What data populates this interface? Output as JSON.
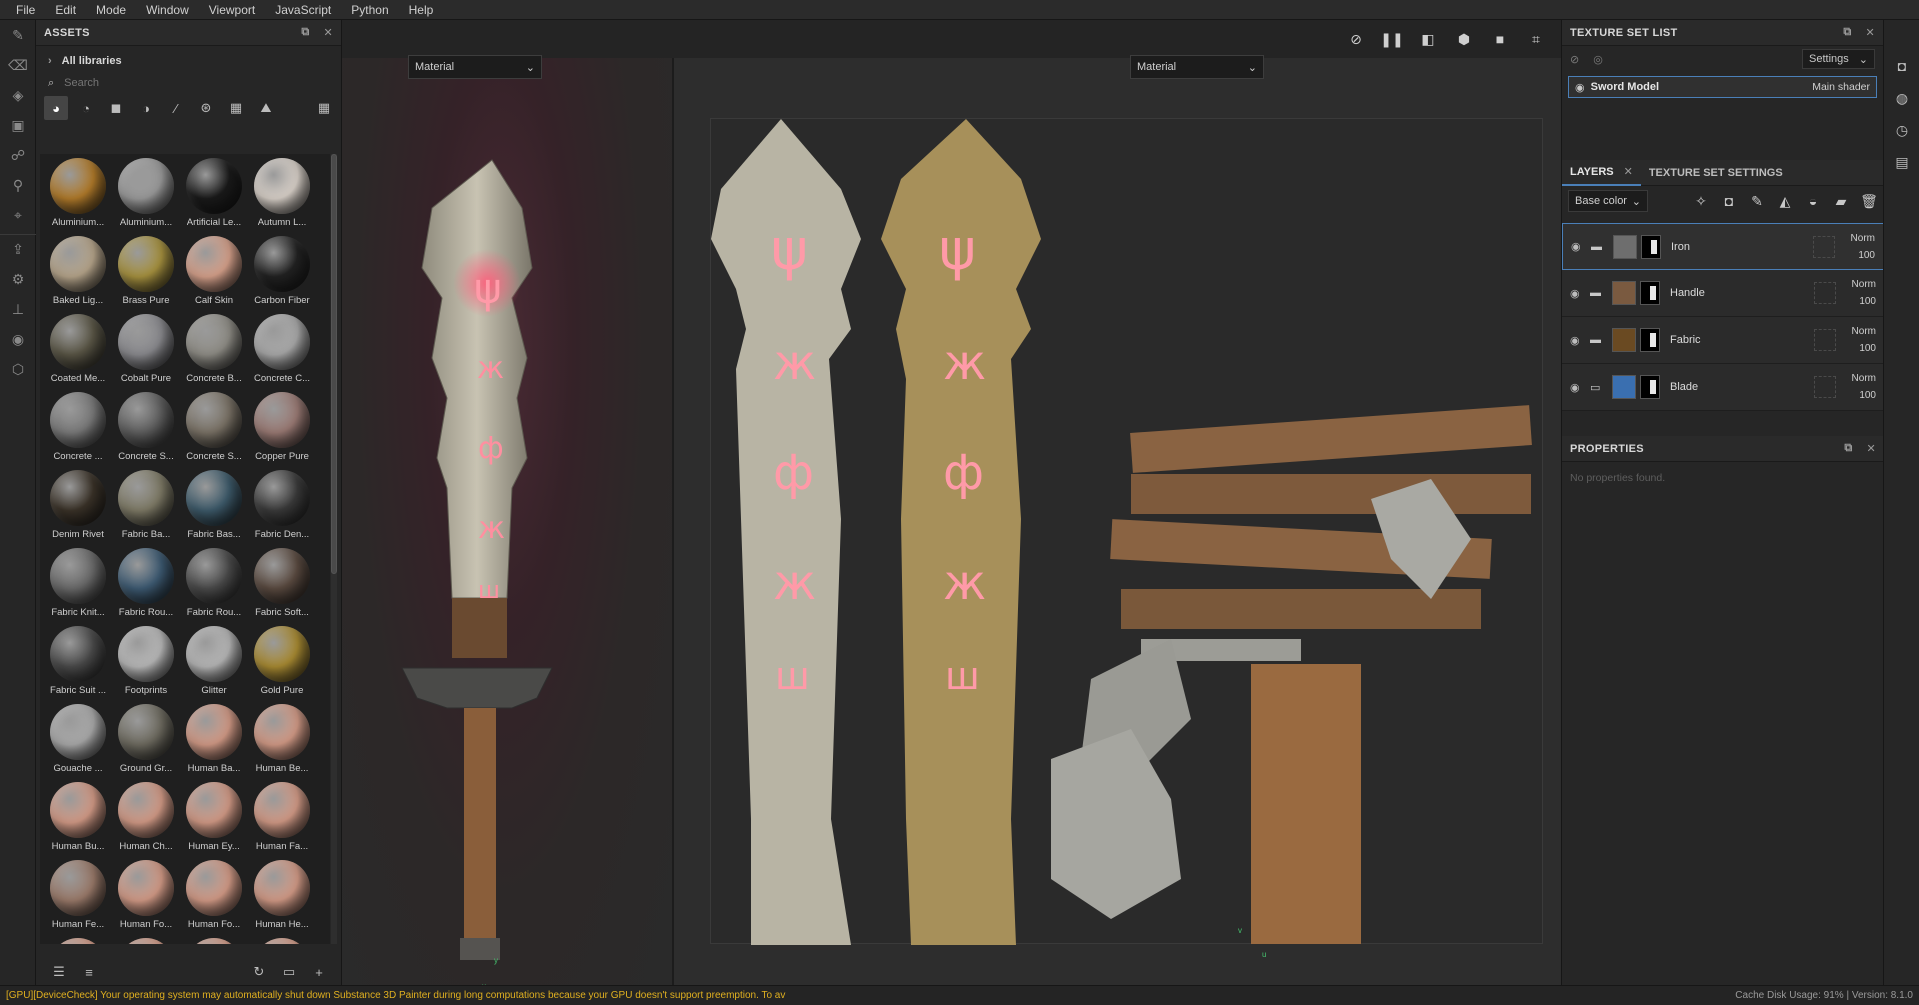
{
  "menu": [
    "File",
    "Edit",
    "Mode",
    "Window",
    "Viewport",
    "JavaScript",
    "Python",
    "Help"
  ],
  "assets": {
    "title": "ASSETS",
    "library": "All libraries",
    "search_placeholder": "Search",
    "items": [
      {
        "label": "Aluminium...",
        "color": "#b07a2a"
      },
      {
        "label": "Aluminium...",
        "color": "#9a9a9a"
      },
      {
        "label": "Artificial Le...",
        "color": "#1a1a1a"
      },
      {
        "label": "Autumn L...",
        "color": "#d8d0c8"
      },
      {
        "label": "Baked Lig...",
        "color": "#b5a48a"
      },
      {
        "label": "Brass Pure",
        "color": "#a6913f"
      },
      {
        "label": "Calf Skin",
        "color": "#d5a08a"
      },
      {
        "label": "Carbon Fiber",
        "color": "#222222"
      },
      {
        "label": "Coated Me...",
        "color": "#5a5646"
      },
      {
        "label": "Cobalt Pure",
        "color": "#8a8a8e"
      },
      {
        "label": "Concrete B...",
        "color": "#8f8d86"
      },
      {
        "label": "Concrete C...",
        "color": "#a9a9a9"
      },
      {
        "label": "Concrete ...",
        "color": "#7a7a7a"
      },
      {
        "label": "Concrete S...",
        "color": "#5f5f5f"
      },
      {
        "label": "Concrete S...",
        "color": "#7a7266"
      },
      {
        "label": "Copper Pure",
        "color": "#9a7a74"
      },
      {
        "label": "Denim Rivet",
        "color": "#3a3228"
      },
      {
        "label": "Fabric Ba...",
        "color": "#7e7a66"
      },
      {
        "label": "Fabric Bas...",
        "color": "#3d5a6a"
      },
      {
        "label": "Fabric Den...",
        "color": "#3a3a3a"
      },
      {
        "label": "Fabric Knit...",
        "color": "#6a6a6a"
      },
      {
        "label": "Fabric Rou...",
        "color": "#3d5a72"
      },
      {
        "label": "Fabric Rou...",
        "color": "#4a4a4a"
      },
      {
        "label": "Fabric Soft...",
        "color": "#5a4a40"
      },
      {
        "label": "Fabric Suit ...",
        "color": "#4a4a4a"
      },
      {
        "label": "Footprints",
        "color": "#b8b8b8"
      },
      {
        "label": "Glitter",
        "color": "#b6b6b6"
      },
      {
        "label": "Gold Pure",
        "color": "#a88a32"
      },
      {
        "label": "Gouache ...",
        "color": "#a9a9a9"
      },
      {
        "label": "Ground Gr...",
        "color": "#6e6b60"
      },
      {
        "label": "Human Ba...",
        "color": "#d29a86"
      },
      {
        "label": "Human Be...",
        "color": "#d29a86"
      },
      {
        "label": "Human Bu...",
        "color": "#d29a86"
      },
      {
        "label": "Human Ch...",
        "color": "#d29a86"
      },
      {
        "label": "Human Ey...",
        "color": "#d29a86"
      },
      {
        "label": "Human Fa...",
        "color": "#d29a86"
      },
      {
        "label": "Human Fe...",
        "color": "#9a7a6a"
      },
      {
        "label": "Human Fo...",
        "color": "#d29a86"
      },
      {
        "label": "Human Fo...",
        "color": "#d29a86"
      },
      {
        "label": "Human He...",
        "color": "#d29a86"
      },
      {
        "label": "",
        "color": "#d29a86"
      },
      {
        "label": "",
        "color": "#d29a86"
      },
      {
        "label": "",
        "color": "#d29a86"
      },
      {
        "label": "",
        "color": "#d29a86"
      }
    ]
  },
  "viewport": {
    "left_mode": "Material",
    "right_mode": "Material",
    "axis_left": {
      "x": "x",
      "y": "y"
    },
    "axis_right": {
      "v": "v",
      "u": "u"
    }
  },
  "texture_set_list": {
    "title": "TEXTURE SET LIST",
    "settings_label": "Settings",
    "item": {
      "name": "Sword Model",
      "shader": "Main shader"
    }
  },
  "layers_panel": {
    "tab_layers": "LAYERS",
    "tab_settings": "TEXTURE SET SETTINGS",
    "channel": "Base color",
    "layers": [
      {
        "name": "Iron",
        "blend": "Norm",
        "opacity": "100",
        "thumb": "#6e6e6e"
      },
      {
        "name": "Handle",
        "blend": "Norm",
        "opacity": "100",
        "thumb": "#7a5a40"
      },
      {
        "name": "Fabric",
        "blend": "Norm",
        "opacity": "100",
        "thumb": "#6a4a22"
      },
      {
        "name": "Blade",
        "blend": "Norm",
        "opacity": "100",
        "thumb": "#3a6fb0"
      }
    ]
  },
  "properties": {
    "title": "PROPERTIES",
    "empty": "No properties found."
  },
  "status": {
    "warning": "[GPU][DeviceCheck] Your operating system may automatically shut down Substance 3D Painter during long computations because your GPU doesn't support preemption. To av",
    "info": "Cache Disk Usage:  91%  |  Version: 8.1.0"
  }
}
